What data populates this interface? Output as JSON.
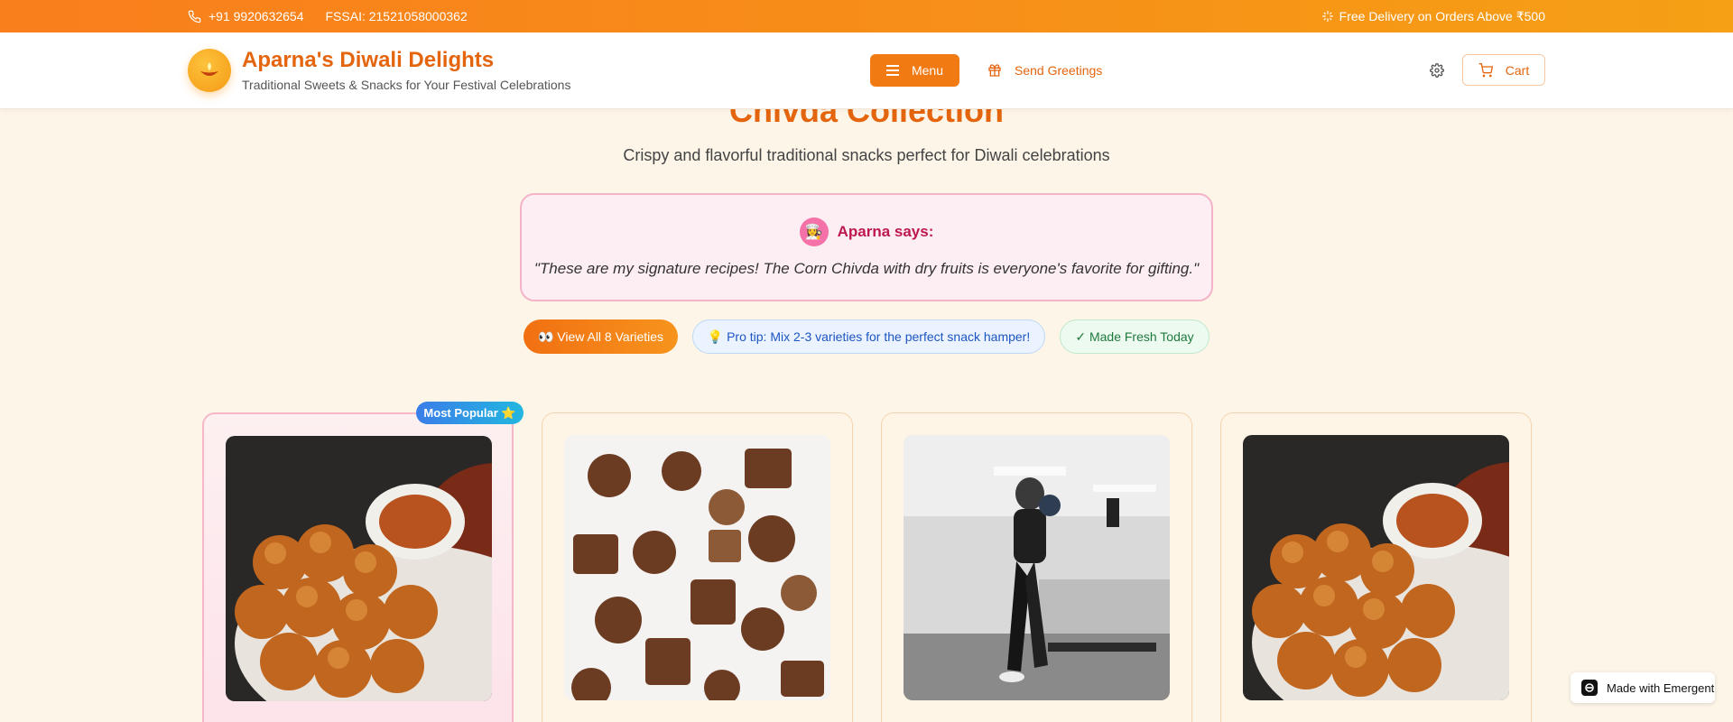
{
  "topbar": {
    "phone": "+91 9920632654",
    "fssai": "FSSAI: 21521058000362",
    "delivery": "Free Delivery on Orders Above ₹500"
  },
  "header": {
    "logo_icon": "diya-lamp",
    "title": "Aparna's Diwali Delights",
    "subtitle": "Traditional Sweets & Snacks for Your Festival Celebrations",
    "menu_label": "Menu",
    "greetings_label": "Send Greetings",
    "cart_label": "Cart"
  },
  "section": {
    "title": "Chivda Collection",
    "subtitle": "Crispy and flavorful traditional snacks perfect for Diwali celebrations"
  },
  "quote": {
    "avatar": "👩‍🍳",
    "author": "Aparna says:",
    "text": "\"These are my signature recipes! The Corn Chivda with dry fruits is everyone's favorite for gifting.\""
  },
  "pills": {
    "varieties": "👀 View All 8 Varieties",
    "tip": "💡 Pro tip: Mix 2-3 varieties for the perfect snack hamper!",
    "fresh": "✓ Made Fresh Today"
  },
  "cards": [
    {
      "badge": "Most Popular ⭐",
      "image": "pav-bhaji-photo"
    },
    {
      "image": "chocolates-photo"
    },
    {
      "image": "boxing-woman-photo"
    },
    {
      "image": "pav-bhaji-photo"
    }
  ],
  "footer_badge": {
    "label": "Made with Emergent"
  },
  "colors": {
    "accent": "#e4650e",
    "topbar": "#f78f18",
    "background": "#fdf6e8"
  }
}
